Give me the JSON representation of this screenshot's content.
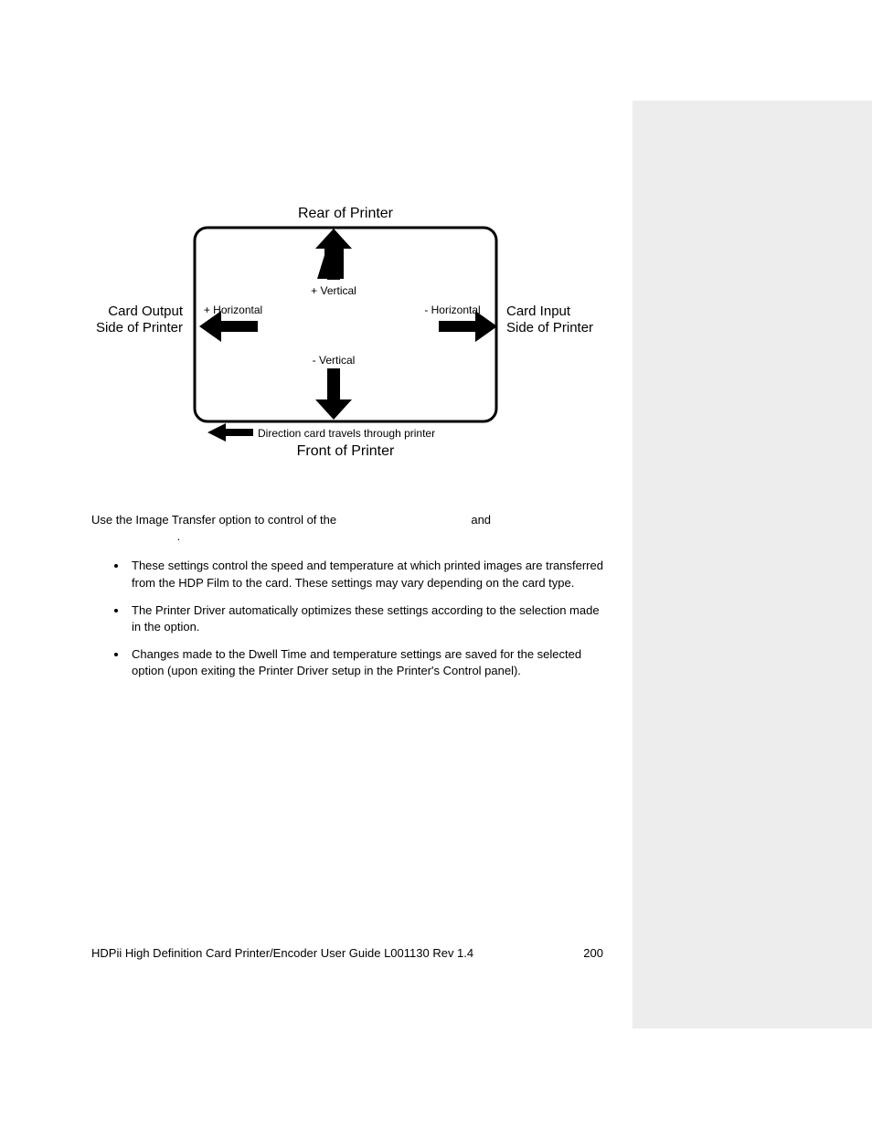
{
  "diagram": {
    "top_label": "Rear of Printer",
    "left_label_line1": "Card Output",
    "left_label_line2": "Side of Printer",
    "right_label_line1": "Card Input",
    "right_label_line2": "Side of Printer",
    "bottom_label": "Front of Printer",
    "plus_vertical": "+ Vertical",
    "minus_vertical": "- Vertical",
    "plus_horizontal": "+ Horizontal",
    "minus_horizontal": "- Horizontal",
    "direction_text": "Direction card travels through printer"
  },
  "body": {
    "intro_a": "Use the Image Transfer option to control of the ",
    "intro_b": " and ",
    "intro_c": ".",
    "bullets": [
      "These settings control the speed and temperature at which printed images are transferred from the HDP Film to the card. These settings may vary depending on the card type.",
      "The Printer Driver automatically optimizes these settings according to the selection made in the                    option.",
      "Changes made to the Dwell Time and temperature settings are saved for the selected                      option (upon exiting the Printer Driver setup in the Printer's Control panel)."
    ]
  },
  "footer": {
    "left": "HDPii High Definition Card Printer/Encoder User Guide    L001130 Rev 1.4",
    "page": "200"
  }
}
